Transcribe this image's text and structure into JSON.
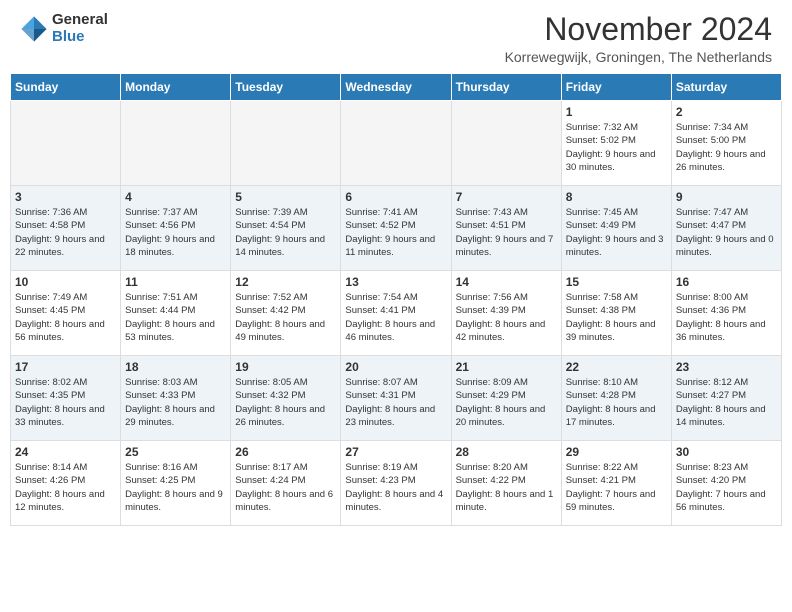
{
  "header": {
    "logo_general": "General",
    "logo_blue": "Blue",
    "month_title": "November 2024",
    "subtitle": "Korrewegwijk, Groningen, The Netherlands"
  },
  "weekdays": [
    "Sunday",
    "Monday",
    "Tuesday",
    "Wednesday",
    "Thursday",
    "Friday",
    "Saturday"
  ],
  "weeks": [
    [
      {
        "day": "",
        "info": ""
      },
      {
        "day": "",
        "info": ""
      },
      {
        "day": "",
        "info": ""
      },
      {
        "day": "",
        "info": ""
      },
      {
        "day": "",
        "info": ""
      },
      {
        "day": "1",
        "info": "Sunrise: 7:32 AM\nSunset: 5:02 PM\nDaylight: 9 hours and 30 minutes."
      },
      {
        "day": "2",
        "info": "Sunrise: 7:34 AM\nSunset: 5:00 PM\nDaylight: 9 hours and 26 minutes."
      }
    ],
    [
      {
        "day": "3",
        "info": "Sunrise: 7:36 AM\nSunset: 4:58 PM\nDaylight: 9 hours and 22 minutes."
      },
      {
        "day": "4",
        "info": "Sunrise: 7:37 AM\nSunset: 4:56 PM\nDaylight: 9 hours and 18 minutes."
      },
      {
        "day": "5",
        "info": "Sunrise: 7:39 AM\nSunset: 4:54 PM\nDaylight: 9 hours and 14 minutes."
      },
      {
        "day": "6",
        "info": "Sunrise: 7:41 AM\nSunset: 4:52 PM\nDaylight: 9 hours and 11 minutes."
      },
      {
        "day": "7",
        "info": "Sunrise: 7:43 AM\nSunset: 4:51 PM\nDaylight: 9 hours and 7 minutes."
      },
      {
        "day": "8",
        "info": "Sunrise: 7:45 AM\nSunset: 4:49 PM\nDaylight: 9 hours and 3 minutes."
      },
      {
        "day": "9",
        "info": "Sunrise: 7:47 AM\nSunset: 4:47 PM\nDaylight: 9 hours and 0 minutes."
      }
    ],
    [
      {
        "day": "10",
        "info": "Sunrise: 7:49 AM\nSunset: 4:45 PM\nDaylight: 8 hours and 56 minutes."
      },
      {
        "day": "11",
        "info": "Sunrise: 7:51 AM\nSunset: 4:44 PM\nDaylight: 8 hours and 53 minutes."
      },
      {
        "day": "12",
        "info": "Sunrise: 7:52 AM\nSunset: 4:42 PM\nDaylight: 8 hours and 49 minutes."
      },
      {
        "day": "13",
        "info": "Sunrise: 7:54 AM\nSunset: 4:41 PM\nDaylight: 8 hours and 46 minutes."
      },
      {
        "day": "14",
        "info": "Sunrise: 7:56 AM\nSunset: 4:39 PM\nDaylight: 8 hours and 42 minutes."
      },
      {
        "day": "15",
        "info": "Sunrise: 7:58 AM\nSunset: 4:38 PM\nDaylight: 8 hours and 39 minutes."
      },
      {
        "day": "16",
        "info": "Sunrise: 8:00 AM\nSunset: 4:36 PM\nDaylight: 8 hours and 36 minutes."
      }
    ],
    [
      {
        "day": "17",
        "info": "Sunrise: 8:02 AM\nSunset: 4:35 PM\nDaylight: 8 hours and 33 minutes."
      },
      {
        "day": "18",
        "info": "Sunrise: 8:03 AM\nSunset: 4:33 PM\nDaylight: 8 hours and 29 minutes."
      },
      {
        "day": "19",
        "info": "Sunrise: 8:05 AM\nSunset: 4:32 PM\nDaylight: 8 hours and 26 minutes."
      },
      {
        "day": "20",
        "info": "Sunrise: 8:07 AM\nSunset: 4:31 PM\nDaylight: 8 hours and 23 minutes."
      },
      {
        "day": "21",
        "info": "Sunrise: 8:09 AM\nSunset: 4:29 PM\nDaylight: 8 hours and 20 minutes."
      },
      {
        "day": "22",
        "info": "Sunrise: 8:10 AM\nSunset: 4:28 PM\nDaylight: 8 hours and 17 minutes."
      },
      {
        "day": "23",
        "info": "Sunrise: 8:12 AM\nSunset: 4:27 PM\nDaylight: 8 hours and 14 minutes."
      }
    ],
    [
      {
        "day": "24",
        "info": "Sunrise: 8:14 AM\nSunset: 4:26 PM\nDaylight: 8 hours and 12 minutes."
      },
      {
        "day": "25",
        "info": "Sunrise: 8:16 AM\nSunset: 4:25 PM\nDaylight: 8 hours and 9 minutes."
      },
      {
        "day": "26",
        "info": "Sunrise: 8:17 AM\nSunset: 4:24 PM\nDaylight: 8 hours and 6 minutes."
      },
      {
        "day": "27",
        "info": "Sunrise: 8:19 AM\nSunset: 4:23 PM\nDaylight: 8 hours and 4 minutes."
      },
      {
        "day": "28",
        "info": "Sunrise: 8:20 AM\nSunset: 4:22 PM\nDaylight: 8 hours and 1 minute."
      },
      {
        "day": "29",
        "info": "Sunrise: 8:22 AM\nSunset: 4:21 PM\nDaylight: 7 hours and 59 minutes."
      },
      {
        "day": "30",
        "info": "Sunrise: 8:23 AM\nSunset: 4:20 PM\nDaylight: 7 hours and 56 minutes."
      }
    ]
  ]
}
